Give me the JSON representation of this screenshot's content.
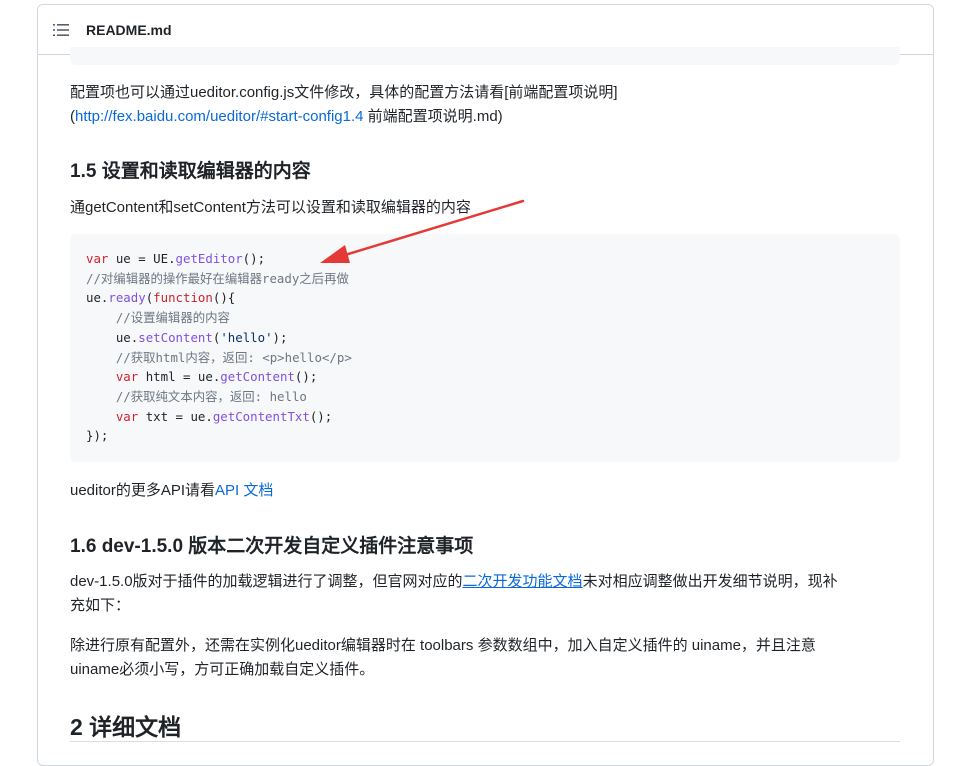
{
  "header": {
    "file_title": "README.md"
  },
  "content": {
    "intro": {
      "line1": "配置项也可以通过ueditor.config.js文件修改，具体的配置方法请看[前端配置项说明]",
      "line2_open": "(",
      "line2_link": "http://fex.baidu.com/ueditor/#start-config1.4",
      "line2_rest": " 前端配置项说明.md)"
    },
    "section15": {
      "heading": "1.5 设置和读取编辑器的内容",
      "desc": "通getContent和setContent方法可以设置和读取编辑器的内容"
    },
    "code": {
      "l1_kw": "var",
      "l1_a": " ue = UE.",
      "l1_fn": "getEditor",
      "l1_b": "();",
      "l2_cm": "//对编辑器的操作最好在编辑器ready之后再做",
      "l3_a": "ue.",
      "l3_fn": "ready",
      "l3_b": "(",
      "l3_kw": "function",
      "l3_c": "(){",
      "l4_cm": "//设置编辑器的内容",
      "l5_a": "ue.",
      "l5_fn": "setContent",
      "l5_b": "(",
      "l5_str": "'hello'",
      "l5_c": ");",
      "l6_cm": "//获取html内容，返回: <p>hello</p>",
      "l7_kw": "var",
      "l7_a": " html = ue.",
      "l7_fn": "getContent",
      "l7_b": "();",
      "l8_cm": "//获取纯文本内容，返回: hello",
      "l9_kw": "var",
      "l9_a": " txt = ue.",
      "l9_fn": "getContentTxt",
      "l9_b": "();",
      "l10": "});"
    },
    "api": {
      "text": "ueditor的更多API请看",
      "link": "API 文档"
    },
    "section16": {
      "heading": "1.6 dev-1.5.0 版本二次开发自定义插件注意事项",
      "p1_a": "dev-1.5.0版对于插件的加载逻辑进行了调整，但官网对应的",
      "p1_link": "二次开发功能文档",
      "p1_b": "未对相应调整做出开发细节说明，现补",
      "p1_c": "充如下：",
      "p2_a": "除进行原有配置外，还需在实例化ueditor编辑器时在 toolbars 参数数组中，加入自定义插件的 uiname，并且注意",
      "p2_b": "uiname必须小写，方可正确加载自定义插件。"
    },
    "section2": {
      "heading": "2 详细文档"
    }
  },
  "colors": {
    "link": "#0969da",
    "annotation_arrow": "#e53935",
    "code_bg": "#f6f8fa"
  },
  "icons": {
    "toc": "list-unordered-icon"
  }
}
